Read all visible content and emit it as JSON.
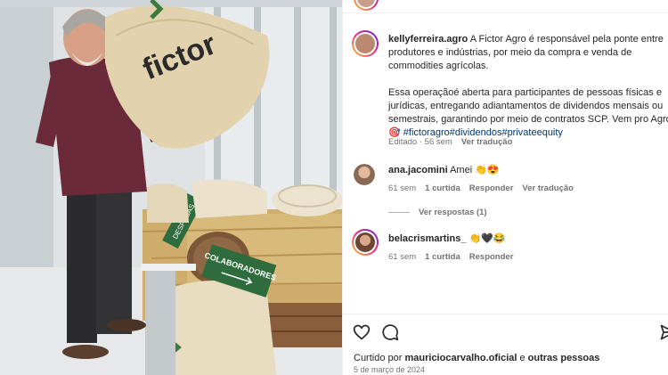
{
  "post": {
    "brand_text": "fictor",
    "sign_text": "COLABORADORES",
    "sign_small_text": "DESPESAS"
  },
  "caption": {
    "username": "kellyferreira.agro",
    "line1": "A Fictor Agro é responsável pela ponte entre",
    "line2": "produtores e indústrias, por meio da compra e venda de",
    "line3": "commodities agrícolas.",
    "line4": "Essa operaçãoé aberta para participantes de pessoas físicas e",
    "line5": "jurídicas, entregando adiantamentos de dividendos mensais ou",
    "line6": "semestrais, garantindo por meio de contratos SCP. Vem pro Agro !",
    "emoji": "🎯",
    "hashtags": "#fictoragro#dividendos#privateequity",
    "edited": "Editado · 56 sem",
    "translate": "Ver tradução"
  },
  "comments": [
    {
      "username": "ana.jacomini",
      "text": "Amei 👏😍",
      "time": "61 sem",
      "likes": "1 curtida",
      "reply": "Responder",
      "translate": "Ver tradução",
      "replies_toggle": "Ver respostas (1)"
    },
    {
      "username": "belacrismartins_",
      "text": "👏🖤😂",
      "time": "61 sem",
      "likes": "1 curtida",
      "reply": "Responder"
    }
  ],
  "likes": {
    "prefix": "Curtido por",
    "user": "mauriciocarvalho.oficial",
    "middle": "e",
    "others": "outras pessoas"
  },
  "date": "5 de março de 2024",
  "icons": [
    "heart-icon",
    "comment-icon",
    "share-icon"
  ]
}
